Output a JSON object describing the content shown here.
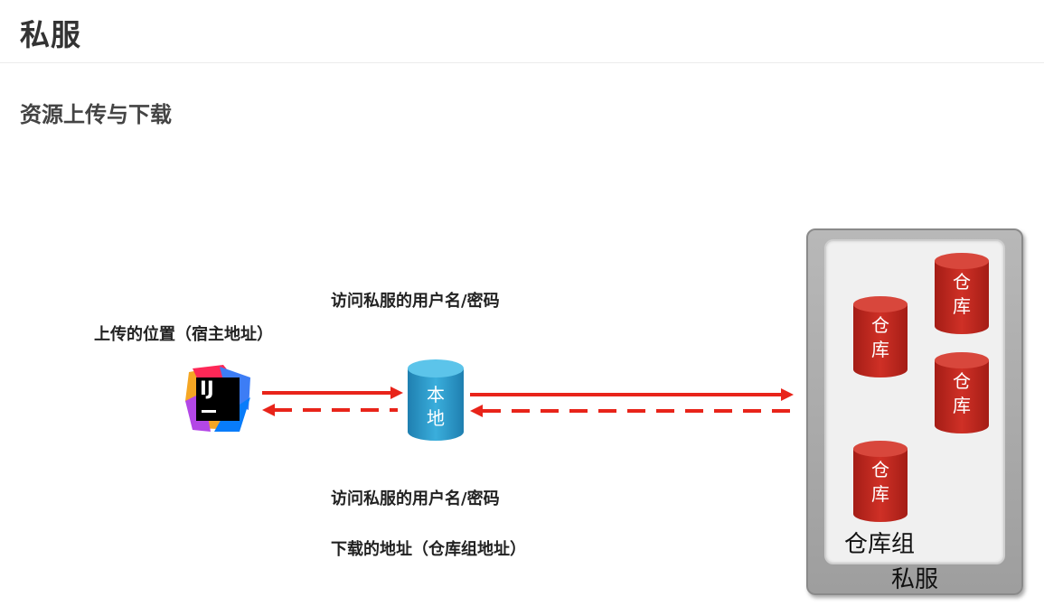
{
  "page": {
    "title": "私服",
    "section_title": "资源上传与下载"
  },
  "labels": {
    "upload_credentials": "访问私服的用户名/密码",
    "upload_location": "上传的位置（宿主地址）",
    "download_credentials": "访问私服的用户名/密码",
    "download_location": "下载的地址（仓库组地址）"
  },
  "nodes": {
    "ide": {
      "icon": "intellij-idea-icon",
      "text": "IJ"
    },
    "local": {
      "line1": "本",
      "line2": "地",
      "color": "#2e9bc9"
    },
    "server": {
      "label": "私服",
      "group_label": "仓库组",
      "repos": [
        {
          "line1": "仓",
          "line2": "库"
        },
        {
          "line1": "仓",
          "line2": "库"
        },
        {
          "line1": "仓",
          "line2": "库"
        },
        {
          "line1": "仓",
          "line2": "库"
        }
      ],
      "repo_color": "#c0281f"
    }
  },
  "colors": {
    "arrow": "#e8241a",
    "box_gray": "#a8a8a8",
    "group_bg": "#f0f0f0"
  }
}
